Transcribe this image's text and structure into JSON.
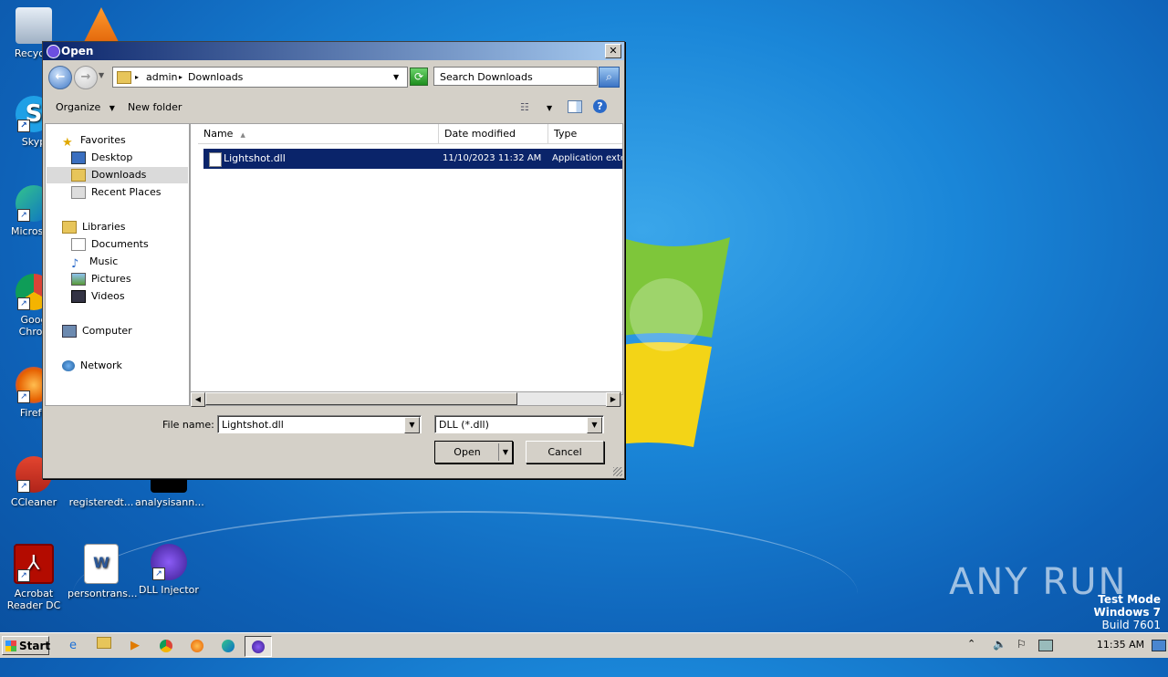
{
  "desktop": {
    "icons": [
      {
        "label": "Recycle"
      },
      {
        "label": "Skyp"
      },
      {
        "label": "Microsoft"
      },
      {
        "label": "Goog\nChron"
      },
      {
        "label": "Firefo"
      },
      {
        "label": "CCleaner"
      },
      {
        "label": "registeredt..."
      },
      {
        "label": "analysisann..."
      },
      {
        "label": "Acrobat Reader DC"
      },
      {
        "label": "persontrans..."
      },
      {
        "label": "DLL Injector"
      }
    ],
    "watermark": {
      "line1": "Test Mode",
      "line2": "Windows 7",
      "line3": "Build 7601"
    },
    "anyrun": "ANY RUN"
  },
  "dialog": {
    "title": "Open",
    "close": "✕",
    "address": {
      "crumb1": "admin",
      "crumb2": "Downloads"
    },
    "search_placeholder": "Search Downloads",
    "toolbar": {
      "organize": "Organize",
      "new_folder": "New folder"
    },
    "nav": {
      "favorites": "Favorites",
      "desktop": "Desktop",
      "downloads": "Downloads",
      "recent": "Recent Places",
      "libraries": "Libraries",
      "documents": "Documents",
      "music": "Music",
      "pictures": "Pictures",
      "videos": "Videos",
      "computer": "Computer",
      "network": "Network"
    },
    "columns": {
      "name": "Name",
      "date": "Date modified",
      "type": "Type"
    },
    "files": [
      {
        "name": "Lightshot.dll",
        "date": "11/10/2023 11:32 AM",
        "type": "Application exte"
      }
    ],
    "filename_label": "File name:",
    "filename_value": "Lightshot.dll",
    "filter_value": "DLL (*.dll)",
    "open_label": "Open",
    "cancel_label": "Cancel"
  },
  "taskbar": {
    "start": "Start",
    "clock": "11:35 AM"
  }
}
